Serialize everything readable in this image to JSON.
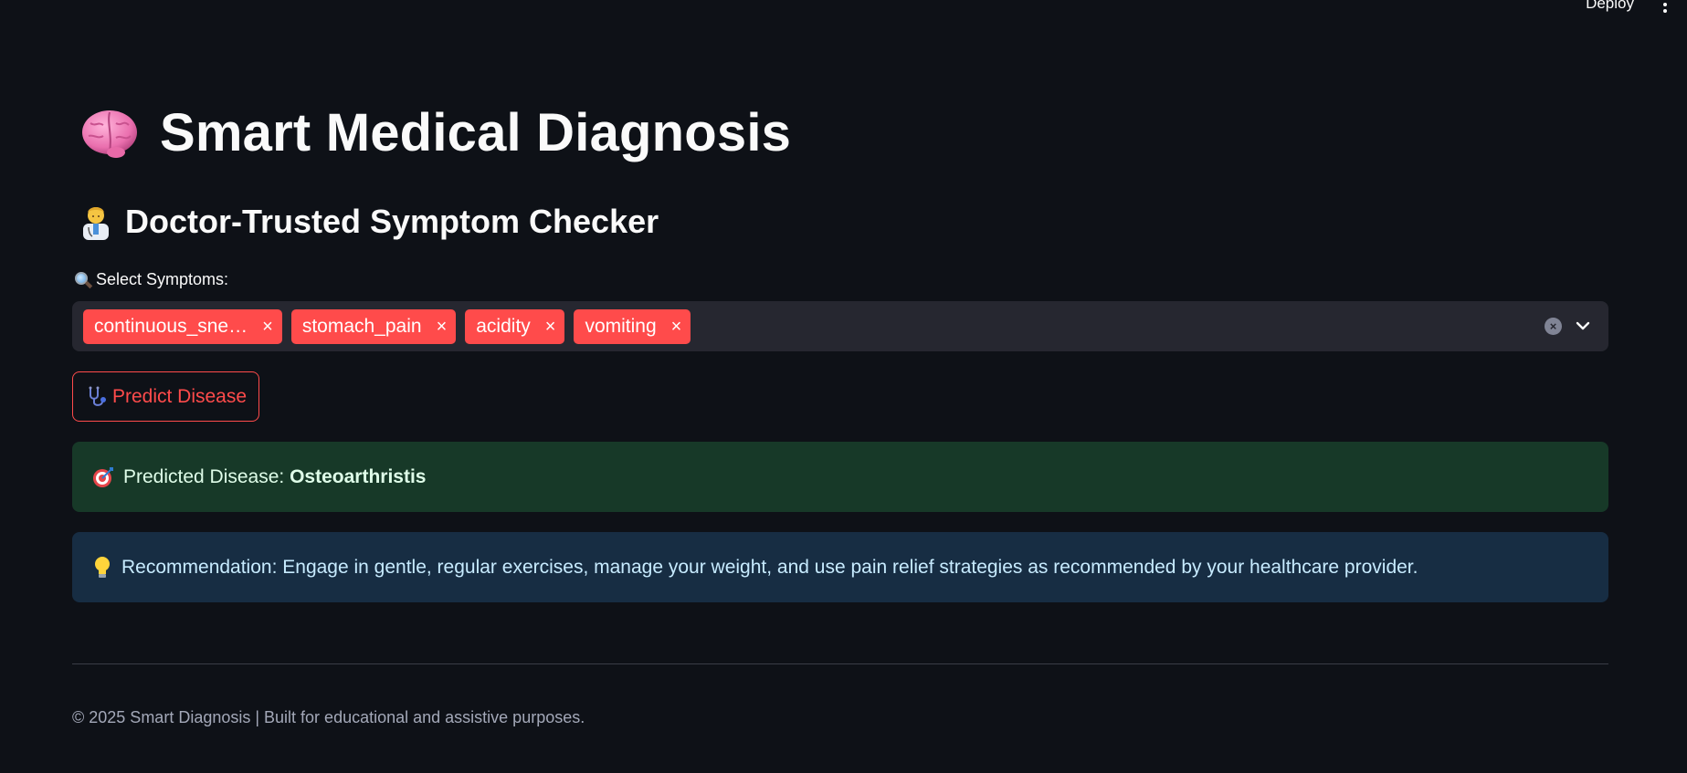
{
  "header": {
    "deploy_label": "Deploy"
  },
  "title": {
    "text": "Smart Medical Diagnosis",
    "icon": "brain-icon"
  },
  "subtitle": {
    "text": "Doctor-Trusted Symptom Checker",
    "icon": "doctor-icon"
  },
  "symptoms": {
    "label": "Select Symptoms:",
    "label_icon": "magnifier-icon",
    "chips": [
      {
        "label": "continuous_sne…"
      },
      {
        "label": "stomach_pain"
      },
      {
        "label": "acidity"
      },
      {
        "label": "vomiting"
      }
    ],
    "chip_close_glyph": "×",
    "clear_glyph": "×"
  },
  "predict_button": {
    "label": "Predict Disease",
    "icon": "stethoscope-icon"
  },
  "prediction": {
    "prefix": "Predicted Disease:",
    "disease": "Osteoarthristis",
    "icon": "dart-icon"
  },
  "recommendation": {
    "text": "Recommendation: Engage in gentle, regular exercises, manage your weight, and use pain relief strategies as recommended by your healthcare provider.",
    "icon": "lightbulb-icon"
  },
  "footer": {
    "text": "© 2025 Smart Diagnosis | Built for educational and assistive purposes."
  },
  "colors": {
    "background": "#0e1117",
    "accent": "#ff4b4b",
    "success_bg": "#173928",
    "info_bg": "#172d43",
    "input_bg": "#262730"
  }
}
